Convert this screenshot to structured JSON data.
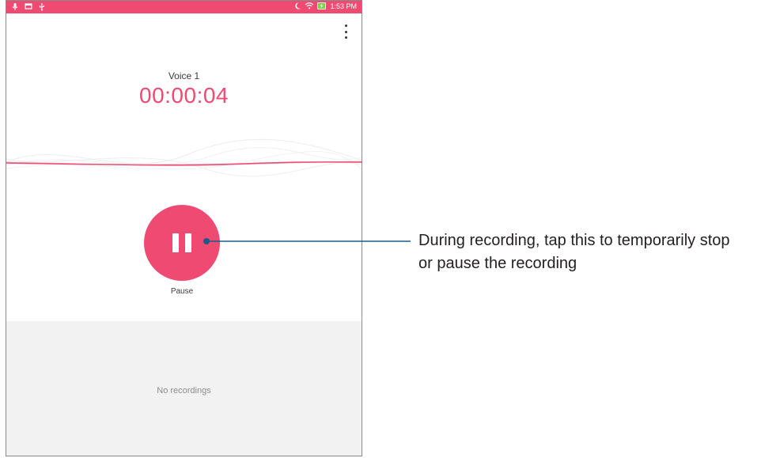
{
  "status_bar": {
    "time": "1:53 PM",
    "icons_left": [
      "mic-icon",
      "message-icon",
      "usb-icon"
    ],
    "icons_right": [
      "moon-icon",
      "wifi-icon",
      "battery-charging-icon"
    ]
  },
  "toolbar": {
    "menu_icon": "more-vert-icon"
  },
  "recorder": {
    "name": "Voice 1",
    "timer": "00:00:04",
    "pause_label": "Pause"
  },
  "recordings": {
    "empty_text": "No recordings"
  },
  "callout": {
    "line1": "During recording, tap this to temporarily stop",
    "line2": "or pause the recording"
  },
  "colors": {
    "accent": "#ee4a72",
    "callout_line": "#1c5a8c",
    "panel": "#f2f2f2"
  }
}
